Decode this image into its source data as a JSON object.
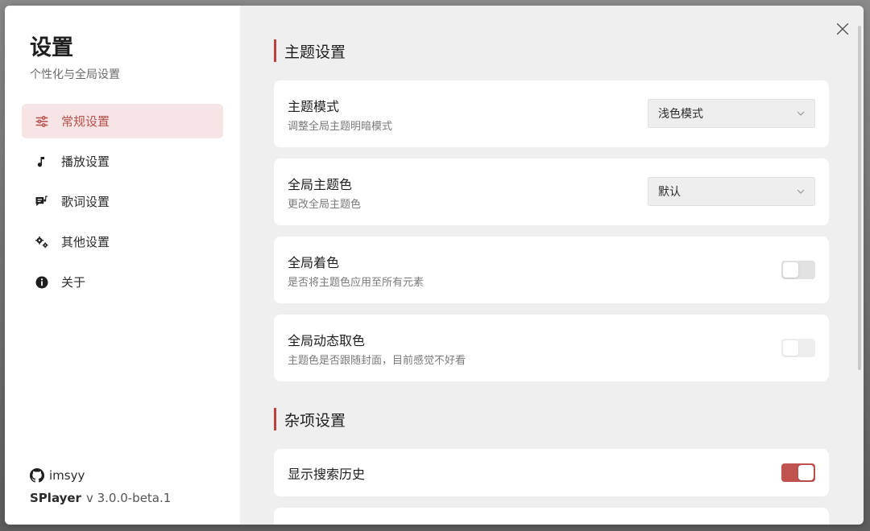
{
  "sidebar": {
    "title": "设置",
    "subtitle": "个性化与全局设置",
    "items": [
      {
        "label": "常规设置",
        "icon": "sliders-icon",
        "active": true
      },
      {
        "label": "播放设置",
        "icon": "music-note-icon",
        "active": false
      },
      {
        "label": "歌词设置",
        "icon": "lyrics-icon",
        "active": false
      },
      {
        "label": "其他设置",
        "icon": "gears-icon",
        "active": false
      },
      {
        "label": "关于",
        "icon": "info-icon",
        "active": false
      }
    ],
    "footer": {
      "github_user": "imsyy",
      "app_name": "SPlayer",
      "version": "v 3.0.0-beta.1"
    }
  },
  "sections": [
    {
      "title": "主题设置",
      "cards": [
        {
          "name": "主题模式",
          "desc": "调整全局主题明暗模式",
          "control": "select",
          "value": "浅色模式"
        },
        {
          "name": "全局主题色",
          "desc": "更改全局主题色",
          "control": "select",
          "value": "默认"
        },
        {
          "name": "全局着色",
          "desc": "是否将主题色应用至所有元素",
          "control": "toggle",
          "value": false
        },
        {
          "name": "全局动态取色",
          "desc": "主题色是否跟随封面，目前感觉不好看",
          "control": "toggle",
          "value": false,
          "disabled": true
        }
      ]
    },
    {
      "title": "杂项设置",
      "cards": [
        {
          "name": "显示搜索历史",
          "control": "toggle",
          "value": true
        }
      ]
    }
  ],
  "colors": {
    "accent": "#c0403d",
    "active_bg": "#f6e5e4",
    "toggle_on": "#c0524f"
  }
}
